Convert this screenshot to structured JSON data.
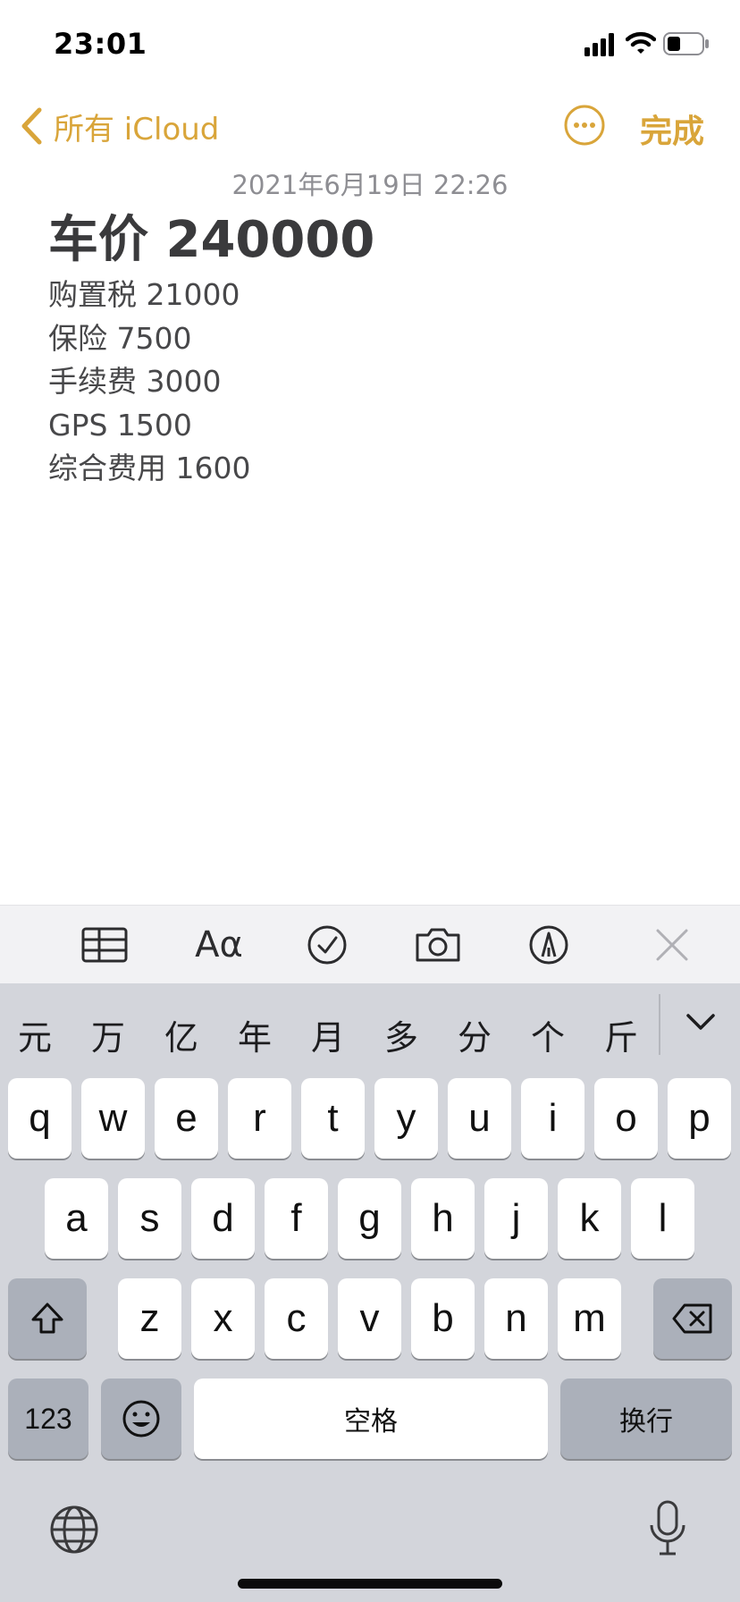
{
  "status_bar": {
    "time": "23:01"
  },
  "nav": {
    "back_label": "所有 iCloud",
    "done_label": "完成"
  },
  "note": {
    "date": "2021年6月19日 22:26",
    "title": "车价 240000",
    "lines": [
      "购置税 21000",
      "保险 7500",
      "手续费 3000",
      "GPS 1500",
      "综合费用 1600"
    ]
  },
  "toolbar": {
    "format_label": "Aα"
  },
  "keyboard": {
    "candidates": [
      "元",
      "万",
      "亿",
      "年",
      "月",
      "多",
      "分",
      "个",
      "斤"
    ],
    "row1": [
      "q",
      "w",
      "e",
      "r",
      "t",
      "y",
      "u",
      "i",
      "o",
      "p"
    ],
    "row2": [
      "a",
      "s",
      "d",
      "f",
      "g",
      "h",
      "j",
      "k",
      "l"
    ],
    "row3": [
      "z",
      "x",
      "c",
      "v",
      "b",
      "n",
      "m"
    ],
    "numbers_label": "123",
    "space_label": "空格",
    "return_label": "换行"
  },
  "colors": {
    "accent": "#d9a53a",
    "keyboard_bg": "#d3d5db",
    "toolbar_bg": "#f2f2f4"
  },
  "icons": [
    "signal-icon",
    "wifi-icon",
    "battery-icon",
    "chevron-left-icon",
    "more-icon",
    "table-icon",
    "checklist-icon",
    "camera-icon",
    "markup-icon",
    "close-icon",
    "chevron-down-icon",
    "shift-icon",
    "delete-icon",
    "emoji-icon",
    "globe-icon",
    "microphone-icon"
  ]
}
